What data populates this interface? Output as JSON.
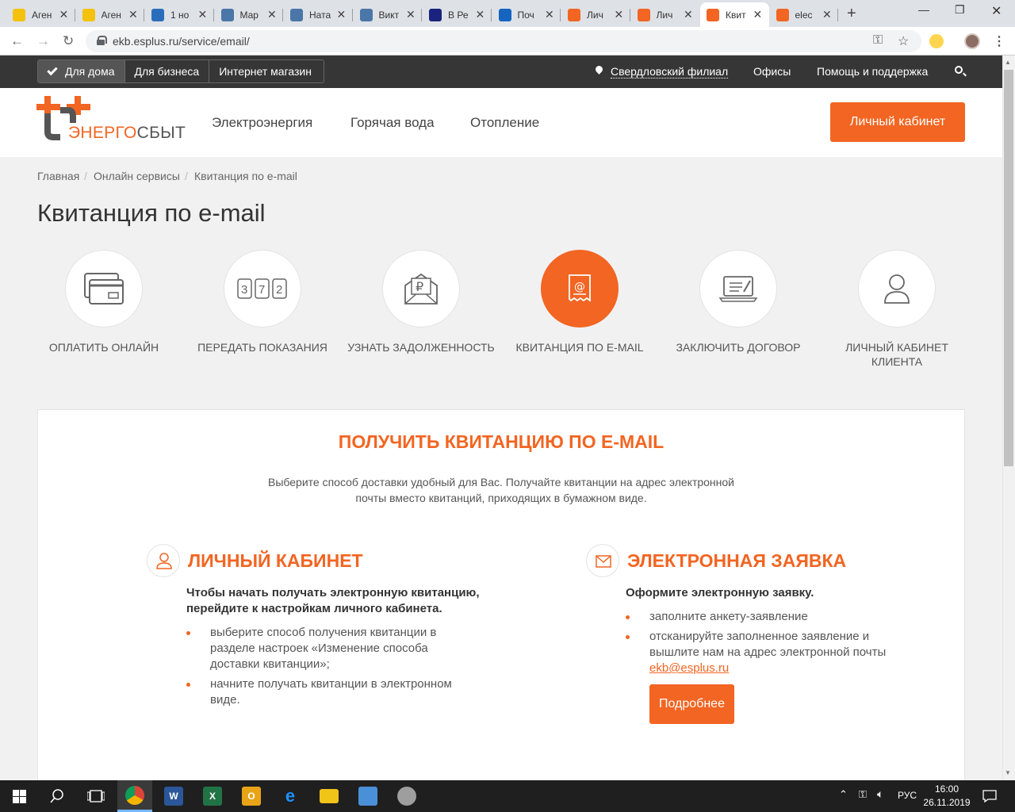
{
  "browser": {
    "tabs": [
      {
        "title": "Аген",
        "favicon_color": "#f4c20d"
      },
      {
        "title": "Аген",
        "favicon_color": "#f4c20d"
      },
      {
        "title": "1 но",
        "favicon_color": "#2a6ebb"
      },
      {
        "title": "Мар",
        "favicon_color": "#4a76a8"
      },
      {
        "title": "Ната",
        "favicon_color": "#4a76a8"
      },
      {
        "title": "Викт",
        "favicon_color": "#4a76a8"
      },
      {
        "title": "В Ре",
        "favicon_color": "#1a237e"
      },
      {
        "title": "Поч",
        "favicon_color": "#1565c0"
      },
      {
        "title": "Лич",
        "favicon_color": "#f26522"
      },
      {
        "title": "Лич",
        "favicon_color": "#f26522"
      },
      {
        "title": "Квит",
        "favicon_color": "#f26522"
      },
      {
        "title": "elec",
        "favicon_color": "#f26522"
      }
    ],
    "active_tab_index": 10,
    "new_tab_label": "+",
    "url": "ekb.esplus.ru/service/email/"
  },
  "topbar": {
    "segments": [
      {
        "label": "Для дома",
        "active": true
      },
      {
        "label": "Для бизнеса",
        "active": false
      },
      {
        "label": "Интернет магазин",
        "active": false
      }
    ],
    "branch": "Свердловский филиал",
    "offices": "Офисы",
    "support": "Помощь и поддержка"
  },
  "header": {
    "logo_part1": "ЭНЕРГО",
    "logo_part2": "СБЫТ",
    "nav": [
      "Электроэнергия",
      "Горячая вода",
      "Отопление"
    ],
    "cabinet_button": "Личный кабинет"
  },
  "breadcrumb": [
    "Главная",
    "Онлайн сервисы",
    "Квитанция по e-mail"
  ],
  "page_title": "Квитанция по e-mail",
  "services": [
    {
      "label": "Оплатить онлайн",
      "icon": "credit-card-icon",
      "active": false
    },
    {
      "label": "Передать показания",
      "icon": "meter-icon",
      "active": false
    },
    {
      "label": "Узнать задолженность",
      "icon": "ruble-envelope-icon",
      "active": false
    },
    {
      "label": "Квитанция по e-mail",
      "icon": "email-receipt-icon",
      "active": true
    },
    {
      "label": "Заключить договор",
      "icon": "laptop-contract-icon",
      "active": false
    },
    {
      "label": "Личный кабинет клиента",
      "icon": "user-icon",
      "active": false
    }
  ],
  "panel": {
    "heading": "ПОЛУЧИТЬ КВИТАНЦИЮ ПО E-MAIL",
    "description": "Выберите способ доставки удобный для Вас. Получайте квитанции на адрес электронной почты вместо квитанций, приходящих в бумажном виде.",
    "left": {
      "title": "ЛИЧНЫЙ КАБИНЕТ",
      "lead": "Чтобы начать получать электронную квитанцию, перейдите к настройкам личного кабинета.",
      "bullets": [
        "выберите способ получения квитанции в разделе настроек «Изменение способа доставки квитанции»;",
        "начните получать квитанции в электронном виде."
      ]
    },
    "right": {
      "title": "ЭЛЕКТРОННАЯ ЗАЯВКА",
      "lead": "Оформите электронную заявку.",
      "bullet1": "заполните анкету-заявление",
      "bullet2": "отсканируйте заполненное заявление и вышлите нам на адрес электронной почты",
      "email": "ekb@esplus.ru",
      "button": "Подробнее"
    }
  },
  "taskbar": {
    "lang": "РУС",
    "time": "16:00",
    "date": "26.11.2019"
  },
  "colors": {
    "accent": "#f26522",
    "dark_bar": "#363636"
  }
}
